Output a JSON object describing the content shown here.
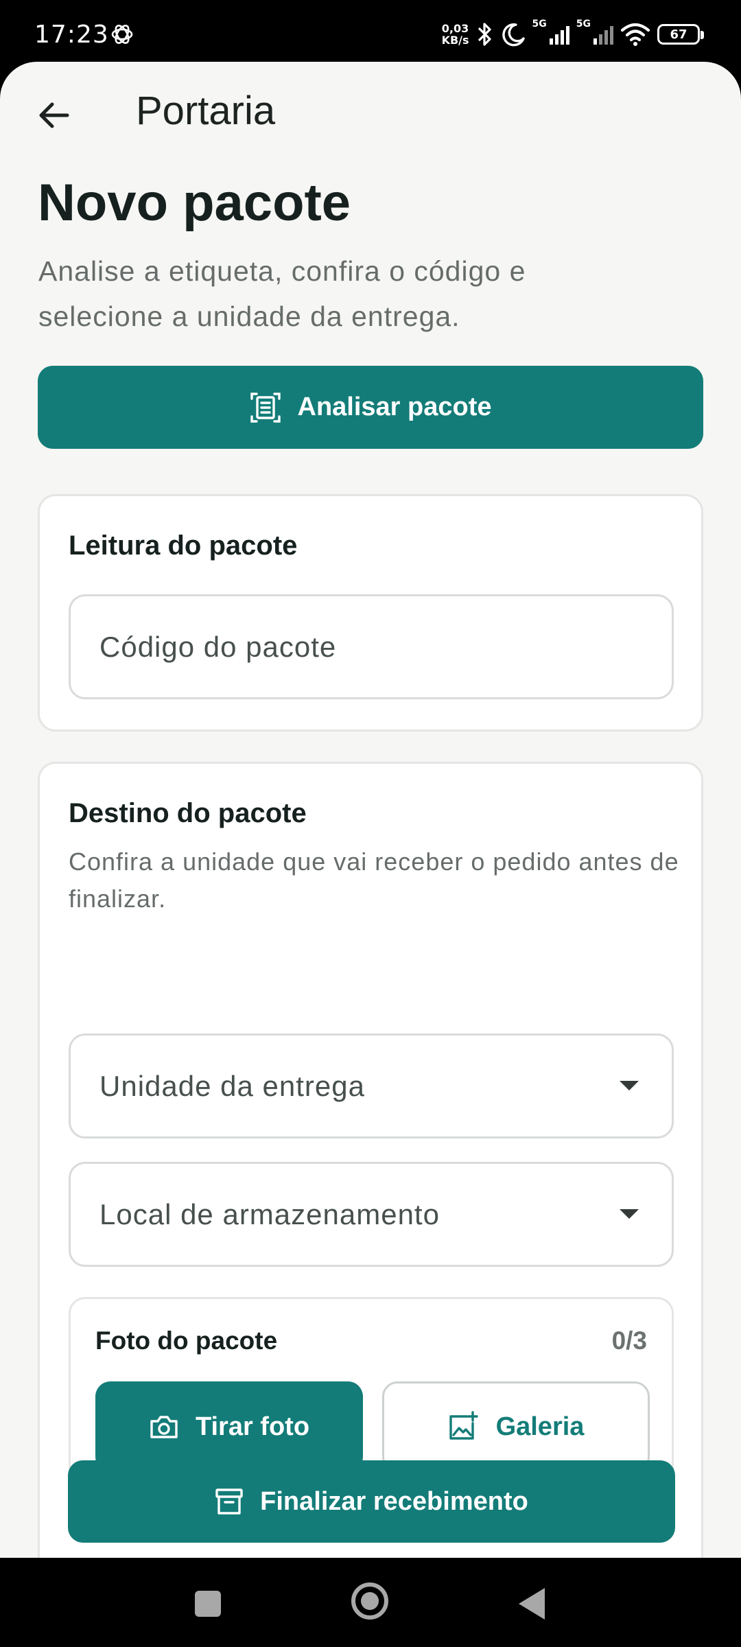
{
  "status_bar": {
    "time": "17:23",
    "network_speed_value": "0,03",
    "network_speed_unit": "KB/s",
    "sim1_label": "5G",
    "sim2_label": "5G",
    "battery_level": "67",
    "icons": [
      "openai-app-icon",
      "bluetooth-icon",
      "moon-icon",
      "signal-icon",
      "signal-icon",
      "wifi-icon",
      "battery-icon"
    ]
  },
  "topbar": {
    "title": "Portaria",
    "back_icon": "arrow-left-icon"
  },
  "header": {
    "title": "Novo pacote",
    "subtitle": "Analise a etiqueta, confira o código e selecione a unidade da entrega."
  },
  "analyze_button": {
    "label": "Analisar pacote",
    "icon": "document-scan-icon"
  },
  "reading_card": {
    "title": "Leitura do pacote",
    "code_field": {
      "value": "",
      "placeholder": "Código do pacote"
    }
  },
  "destination_card": {
    "title": "Destino do pacote",
    "description": "Confira a unidade que vai receber o pedido antes de finalizar.",
    "unit_select": {
      "placeholder": "Unidade da entrega",
      "icon": "caret-down-icon"
    },
    "storage_select": {
      "placeholder": "Local de armazenamento",
      "icon": "caret-down-icon"
    },
    "photo": {
      "title": "Foto do pacote",
      "count": "0/3",
      "take_photo_label": "Tirar foto",
      "take_photo_icon": "camera-icon",
      "gallery_label": "Galeria",
      "gallery_icon": "add-photo-icon"
    }
  },
  "finish_button": {
    "label": "Finalizar recebimento",
    "icon": "archive-box-icon"
  },
  "colors": {
    "accent": "#137c78",
    "background": "#f6f6f4",
    "card": "#ffffff",
    "text_primary": "#16211f",
    "text_secondary": "#666c6a"
  }
}
